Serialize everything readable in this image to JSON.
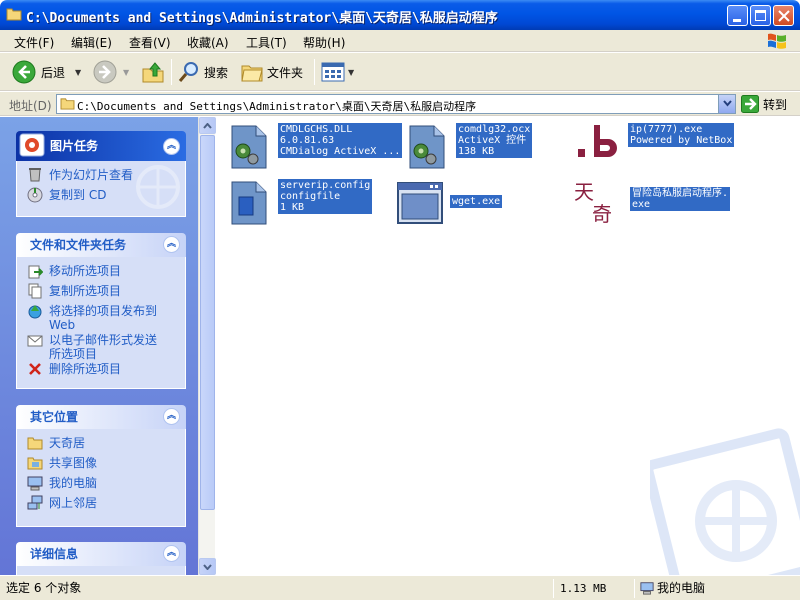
{
  "window": {
    "title": "C:\\Documents and Settings\\Administrator\\桌面\\天奇居\\私服启动程序"
  },
  "menu": {
    "items": [
      "文件(F)",
      "编辑(E)",
      "查看(V)",
      "收藏(A)",
      "工具(T)",
      "帮助(H)"
    ]
  },
  "toolbar": {
    "back_label": "后退",
    "search_label": "搜索",
    "folders_label": "文件夹"
  },
  "address": {
    "label": "地址(D)",
    "value": "C:\\Documents and Settings\\Administrator\\桌面\\天奇居\\私服启动程序",
    "go_label": "转到"
  },
  "left_pane": {
    "picture_tasks": {
      "title": "图片任务",
      "items": [
        "作为幻灯片查看",
        "复制到 CD"
      ]
    },
    "file_tasks": {
      "title": "文件和文件夹任务",
      "items": [
        "移动所选项目",
        "复制所选项目",
        "将选择的项目发布到 Web",
        "以电子邮件形式发送所选项目",
        "删除所选项目"
      ]
    },
    "other_places": {
      "title": "其它位置",
      "items": [
        "天奇居",
        "共享图像",
        "我的电脑",
        "网上邻居"
      ]
    },
    "details": {
      "title": "详细信息"
    }
  },
  "files": [
    {
      "name": "CMDLGCHS.DLL",
      "line2": "6.0.81.63",
      "line3": "CMDialog ActiveX ...",
      "icon": "dll-icon"
    },
    {
      "name": "comdlg32.ocx",
      "line2": "ActiveX 控件",
      "line3": "138 KB",
      "icon": "ocx-icon"
    },
    {
      "name": "ip(7777).exe",
      "line2": "Powered by NetBox",
      "line3": "",
      "icon": "netbox-icon"
    },
    {
      "name": "serverip.config",
      "line2": "configfile",
      "line3": "1 KB",
      "icon": "config-file-icon"
    },
    {
      "name": "wget.exe",
      "line2": "",
      "line3": "",
      "icon": "exe-window-icon"
    },
    {
      "name": "冒险岛私服启动程序.",
      "line2": "exe",
      "line3": "",
      "icon": "tianqi-logo-icon"
    }
  ],
  "status": {
    "selection": "选定 6 个对象",
    "size": "1.13 MB",
    "zone": "我的电脑"
  },
  "colors": {
    "title_bar": "#0055e5",
    "selection": "#316ac5",
    "task_pane": "#6375d6",
    "link": "#215dc6"
  }
}
